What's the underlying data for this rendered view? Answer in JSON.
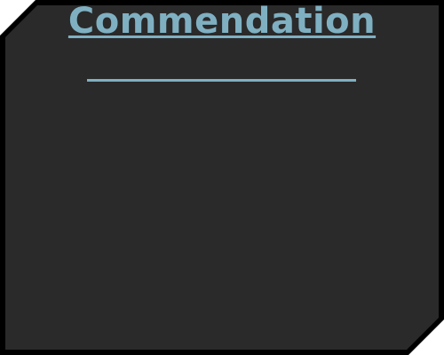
{
  "panel": {
    "title": "Commendation"
  },
  "colors": {
    "accent": "#7fb0c2",
    "panel_background": "#2a2a2a",
    "frame": "#000000"
  }
}
